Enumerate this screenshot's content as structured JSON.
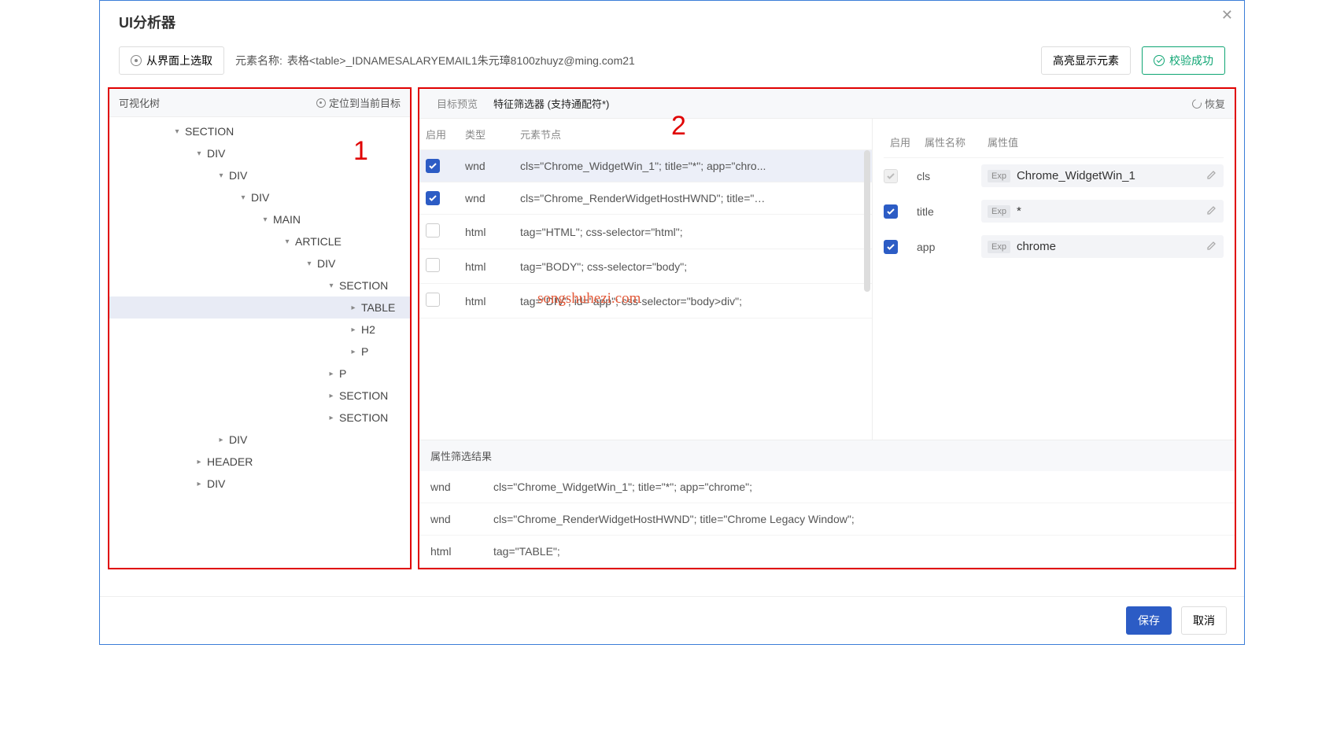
{
  "title": "UI分析器",
  "toolbar": {
    "pick_label": "从界面上选取",
    "name_label": "元素名称:",
    "name_value": "表格<table>_IDNAMESALARYEMAIL1朱元璋8100zhuyz@ming.com21",
    "highlight_label": "高亮显示元素",
    "validate_label": "校验成功"
  },
  "annotations": {
    "one": "1",
    "two": "2"
  },
  "left_panel": {
    "title": "可视化树",
    "locate_label": "定位到当前目标",
    "tree": [
      {
        "label": "SECTION",
        "indent": 80,
        "caret": "down"
      },
      {
        "label": "DIV",
        "indent": 108,
        "caret": "down"
      },
      {
        "label": "DIV",
        "indent": 136,
        "caret": "down"
      },
      {
        "label": "DIV",
        "indent": 164,
        "caret": "down"
      },
      {
        "label": "MAIN",
        "indent": 192,
        "caret": "down"
      },
      {
        "label": "ARTICLE",
        "indent": 220,
        "caret": "down"
      },
      {
        "label": "DIV",
        "indent": 248,
        "caret": "down"
      },
      {
        "label": "SECTION",
        "indent": 276,
        "caret": "down"
      },
      {
        "label": "TABLE",
        "indent": 304,
        "caret": "right",
        "selected": true
      },
      {
        "label": "H2",
        "indent": 304,
        "caret": "right"
      },
      {
        "label": "P",
        "indent": 304,
        "caret": "right"
      },
      {
        "label": "P",
        "indent": 276,
        "caret": "right"
      },
      {
        "label": "SECTION",
        "indent": 276,
        "caret": "right"
      },
      {
        "label": "SECTION",
        "indent": 276,
        "caret": "right"
      },
      {
        "label": "DIV",
        "indent": 136,
        "caret": "right"
      },
      {
        "label": "HEADER",
        "indent": 108,
        "caret": "right"
      },
      {
        "label": "DIV",
        "indent": 108,
        "caret": "right"
      }
    ]
  },
  "right_panel": {
    "tabs": {
      "preview": "目标预览",
      "filter": "特征筛选器 (支持通配符*)"
    },
    "restore_label": "恢复",
    "headers": {
      "enable": "启用",
      "type": "类型",
      "node": "元素节点"
    },
    "rows": [
      {
        "checked": true,
        "type": "wnd",
        "node": "cls=\"Chrome_WidgetWin_1\"; title=\"*\"; app=\"chro...",
        "selected": true
      },
      {
        "checked": true,
        "type": "wnd",
        "node": "cls=\"Chrome_RenderWidgetHostHWND\"; title=\"Ch..."
      },
      {
        "checked": false,
        "type": "html",
        "node": "tag=\"HTML\"; css-selector=\"html\";"
      },
      {
        "checked": false,
        "type": "html",
        "node": "tag=\"BODY\"; css-selector=\"body\";"
      },
      {
        "checked": false,
        "type": "html",
        "node": "tag=\"DIV\"; id=\"app\"; css-selector=\"body>div\";"
      }
    ],
    "attr_headers": {
      "enable": "启用",
      "name": "属性名称",
      "value": "属性值"
    },
    "attrs": [
      {
        "checked": "disabled",
        "name": "cls",
        "exp": "Exp",
        "value": "Chrome_WidgetWin_1"
      },
      {
        "checked": true,
        "name": "title",
        "exp": "Exp",
        "value": "*"
      },
      {
        "checked": true,
        "name": "app",
        "exp": "Exp",
        "value": "chrome"
      }
    ],
    "results_title": "属性筛选结果",
    "results": [
      {
        "type": "wnd",
        "desc": "cls=\"Chrome_WidgetWin_1\"; title=\"*\"; app=\"chrome\";"
      },
      {
        "type": "wnd",
        "desc": "cls=\"Chrome_RenderWidgetHostHWND\"; title=\"Chrome Legacy Window\";"
      },
      {
        "type": "html",
        "desc": "tag=\"TABLE\";"
      }
    ]
  },
  "watermark": "songshuhezi.com",
  "footer": {
    "save": "保存",
    "cancel": "取消"
  }
}
